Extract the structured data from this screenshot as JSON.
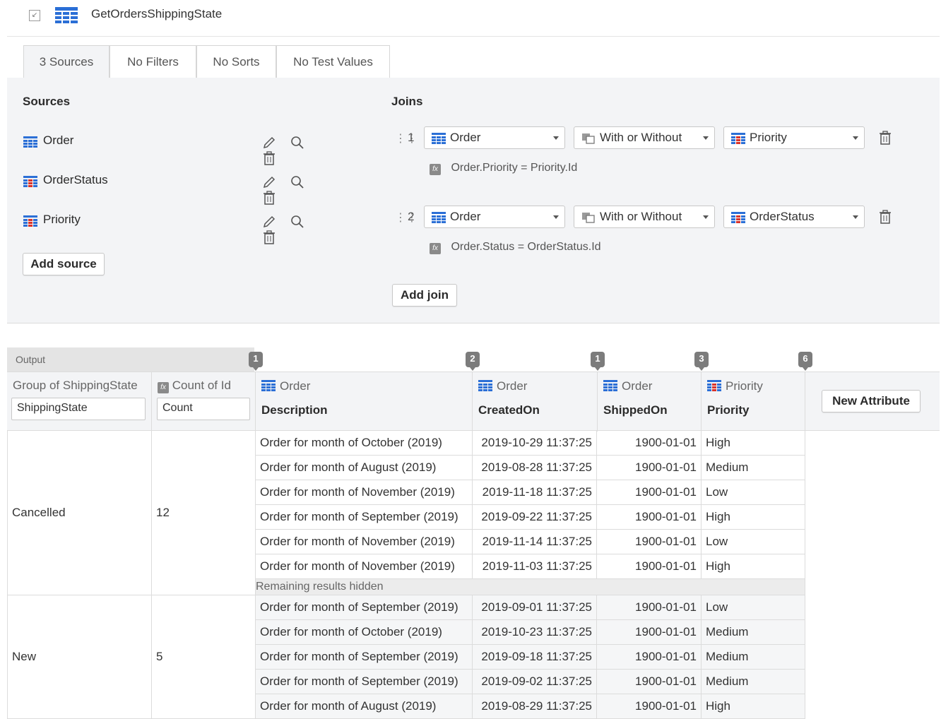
{
  "title": "GetOrdersShippingState",
  "tabs": [
    "3 Sources",
    "No Filters",
    "No Sorts",
    "No Test Values"
  ],
  "sources": {
    "header": "Sources",
    "items": [
      {
        "name": "Order"
      },
      {
        "name": "OrderStatus"
      },
      {
        "name": "Priority"
      }
    ],
    "add_label": "Add source"
  },
  "joins": {
    "header": "Joins",
    "items": [
      {
        "index": "1",
        "left": "Order",
        "type": "With or Without",
        "right": "Priority",
        "condition": "Order.Priority = Priority.Id"
      },
      {
        "index": "2",
        "left": "Order",
        "type": "With or Without",
        "right": "OrderStatus",
        "condition": "Order.Status = OrderStatus.Id"
      }
    ],
    "add_label": "Add join"
  },
  "output": {
    "label": "Output",
    "badges": [
      "1",
      "2",
      "1",
      "3",
      "6"
    ],
    "group_col": {
      "title": "Group of ShippingState",
      "value": "ShippingState"
    },
    "count_col": {
      "title": "Count of Id",
      "value": "Count"
    },
    "columns": [
      {
        "entity": "Order",
        "attribute": "Description"
      },
      {
        "entity": "Order",
        "attribute": "CreatedOn"
      },
      {
        "entity": "Order",
        "attribute": "ShippedOn"
      },
      {
        "entity": "Priority",
        "attribute": "Priority"
      }
    ],
    "new_attribute_label": "New Attribute",
    "groups": [
      {
        "group": "Cancelled",
        "count": "12",
        "rows": [
          [
            "Order for month of October (2019)",
            "2019-10-29 11:37:25",
            "1900-01-01",
            "High"
          ],
          [
            "Order for month of August (2019)",
            "2019-08-28 11:37:25",
            "1900-01-01",
            "Medium"
          ],
          [
            "Order for month of November (2019)",
            "2019-11-18 11:37:25",
            "1900-01-01",
            "Low"
          ],
          [
            "Order for month of September (2019)",
            "2019-09-22 11:37:25",
            "1900-01-01",
            "High"
          ],
          [
            "Order for month of November (2019)",
            "2019-11-14 11:37:25",
            "1900-01-01",
            "Low"
          ],
          [
            "Order for month of November (2019)",
            "2019-11-03 11:37:25",
            "1900-01-01",
            "High"
          ]
        ],
        "hidden_note": "Remaining results hidden"
      },
      {
        "group": "New",
        "count": "5",
        "rows": [
          [
            "Order for month of September (2019)",
            "2019-09-01 11:37:25",
            "1900-01-01",
            "Low"
          ],
          [
            "Order for month of October (2019)",
            "2019-10-23 11:37:25",
            "1900-01-01",
            "Medium"
          ],
          [
            "Order for month of September (2019)",
            "2019-09-18 11:37:25",
            "1900-01-01",
            "Medium"
          ],
          [
            "Order for month of September (2019)",
            "2019-09-02 11:37:25",
            "1900-01-01",
            "Medium"
          ],
          [
            "Order for month of August (2019)",
            "2019-08-29 11:37:25",
            "1900-01-01",
            "High"
          ]
        ]
      }
    ]
  },
  "colors": {
    "entity_icon": "#2b6fd6",
    "static_entity_icon": "#d9342b",
    "panel_bg": "#f3f4f6"
  }
}
